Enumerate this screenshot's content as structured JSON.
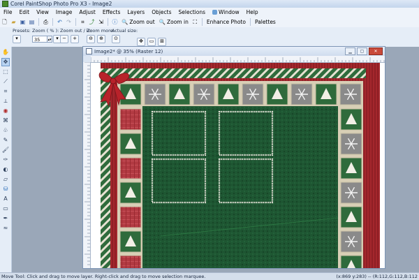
{
  "app": {
    "title": "Corel PaintShop Photo Pro X3 - Image2"
  },
  "menu": {
    "items": [
      "File",
      "Edit",
      "View",
      "Image",
      "Adjust",
      "Effects",
      "Layers",
      "Objects",
      "Selections",
      "Window",
      "Help"
    ]
  },
  "toolbar": {
    "zoom_out_label": "Zoom out",
    "zoom_in_label": "Zoom in",
    "enhance_photo_label": "Enhance Photo",
    "palettes_label": "Palettes"
  },
  "options": {
    "presets_label": "Presets:",
    "zoom_pct_label": "Zoom ( % ):",
    "zoom_value": "35",
    "zoom_out_in_label": "Zoom out / in:",
    "zoom_more_label": "Zoom more:",
    "actual_size_label": "Actual size:"
  },
  "document": {
    "title": "Image2* @  35% (Raster 12)"
  },
  "status": {
    "text": "Move Tool: Click and drag to move layer. Right-click and drag to move selection marquee.",
    "coords": "(x:869 y:283) -- (R:112,G:112,B:112"
  },
  "colors": {
    "border_green": "#2f6b3c",
    "border_red": "#a0252a",
    "mat_beige": "#d8cfb6",
    "center_green": "#1d5230",
    "tile_grey": "#8a8a8a",
    "bow_red": "#b8222a"
  }
}
